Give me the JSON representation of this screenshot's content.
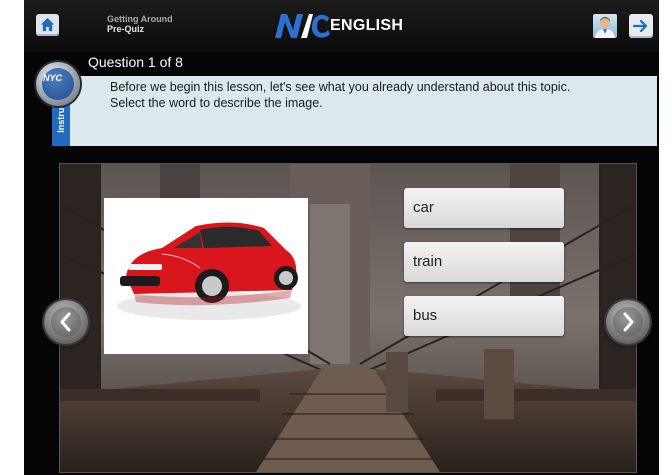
{
  "header": {
    "breadcrumb_top": "Getting Around",
    "breadcrumb_sub": "Pre-Quiz",
    "logo_word": "ENGLISH"
  },
  "quiz": {
    "question_counter": "Question 1 of 8",
    "instructions_tab": "Instructions",
    "instructions_text": "Before we begin this lesson, let's see what you already understand about this topic. Select the word to describe the image."
  },
  "answers": [
    "car",
    "train",
    "bus"
  ],
  "badge_text": "NYC",
  "colors": {
    "accent_blue": "#1f6bbd",
    "instructions_bg": "#dbe9ef",
    "car_red": "#d9161b"
  },
  "icons": {
    "home": "home-icon",
    "next": "arrow-right-icon",
    "prev_slide": "chevron-left-icon",
    "next_slide": "chevron-right-icon"
  }
}
